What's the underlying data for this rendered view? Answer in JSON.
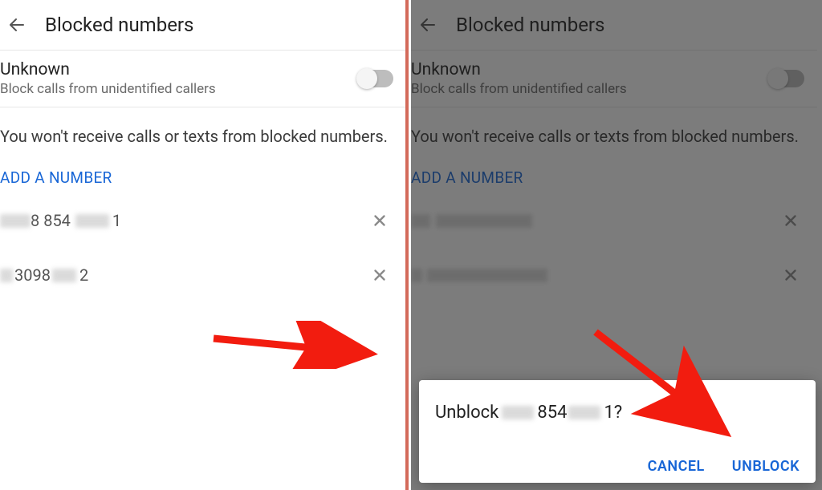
{
  "header": {
    "title": "Blocked numbers"
  },
  "unknown": {
    "title": "Unknown",
    "subtitle": "Block calls from unidentified callers"
  },
  "info": "You won't receive calls or texts from blocked numbers.",
  "add_label": "ADD A NUMBER",
  "numbers": {
    "row1_mid": "8 854",
    "row1_end": "1",
    "row2_pre": "3098",
    "row2_end": "2"
  },
  "dialog": {
    "prefix": "Unblock ",
    "mid": " 854 ",
    "suffix": "1?",
    "cancel": "CANCEL",
    "unblock": "UNBLOCK"
  }
}
